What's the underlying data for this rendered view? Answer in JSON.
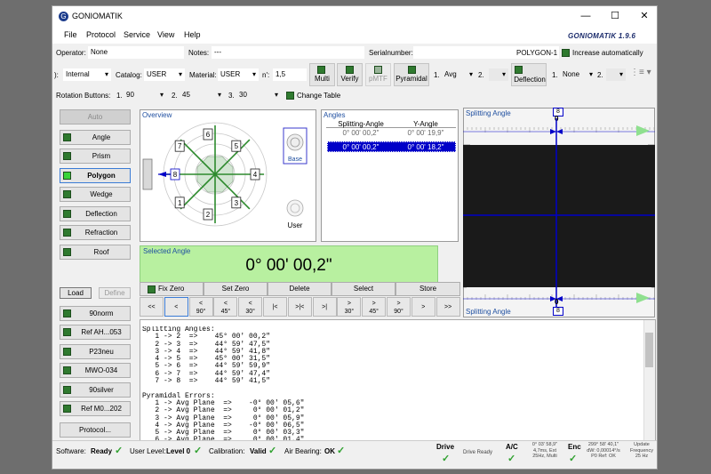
{
  "window": {
    "title": "GONIOMATIK",
    "brand": "GONIOMATIK 1.9.6",
    "minimize": "—",
    "maximize": "☐",
    "close": "✕"
  },
  "menu": [
    "File",
    "Protocol",
    "Service",
    "View",
    "Help"
  ],
  "row1": {
    "operator_label": "Operator:",
    "operator_value": "None",
    "notes_label": "Notes:",
    "notes_value": "---",
    "serial_label": "Serialnumber:",
    "serial_value": "",
    "profile": "POLYGON-1",
    "increase_label": "Increase automatically"
  },
  "row2": {
    "mode_label": "):",
    "mode_value": "Internal",
    "catalog_label": "Catalog:",
    "catalog_value": "USER",
    "material_label": "Material:",
    "material_value": "USER",
    "n_label": "n':",
    "n_value": "1,5",
    "multi": "Multi",
    "verify": "Verify",
    "pmtf": "pMTF",
    "pyramidal": "Pyramidal",
    "p1_label": "1.",
    "p1_value": "Avg",
    "p2_label": "2.",
    "deflection": "Deflection",
    "d1_label": "1.",
    "d1_value": "None",
    "d2_label": "2."
  },
  "row3": {
    "label": "Rotation Buttons:",
    "r1_label": "1.",
    "r1_value": "90",
    "r2_label": "2.",
    "r2_value": "45",
    "r3_label": "3.",
    "r3_value": "30",
    "change_table": "Change Table"
  },
  "sidebar": {
    "auto": "Auto",
    "modes": [
      "Angle",
      "Prism",
      "Polygon",
      "Wedge",
      "Deflection",
      "Refraction",
      "Roof"
    ],
    "load": "Load",
    "define": "Define",
    "presets": [
      "90norm",
      "Ref AH...053",
      "P23neu",
      "MWO-034",
      "90silver",
      "Ref M0...202"
    ],
    "protocol": "Protocol..."
  },
  "overview": {
    "title": "Overview",
    "base": "Base",
    "user": "User",
    "faces": [
      "1",
      "2",
      "3",
      "4",
      "5",
      "6",
      "7",
      "8"
    ]
  },
  "angles": {
    "title": "Angles",
    "col1": "Splitting-Angle",
    "col2": "Y-Angle",
    "rows": [
      [
        "0° 00' 00,2\"",
        "0° 00' 19,9\""
      ],
      [
        "0° 00' 00,2\"",
        "0° 00' 18,2\""
      ]
    ]
  },
  "splitting": {
    "title_top": "Splitting Angle",
    "title_bottom": "Splitting Angle",
    "face_top": "8",
    "zero_top": "0",
    "face_bottom": "8",
    "zero_bottom": "0"
  },
  "selected": {
    "title": "Selected Angle",
    "value": "0° 00' 00,2\""
  },
  "commands": [
    "Fix Zero",
    "Set Zero",
    "Delete",
    "Select",
    "Store"
  ],
  "nav": [
    [
      "<<",
      ""
    ],
    [
      "<",
      ""
    ],
    [
      "<",
      "90°"
    ],
    [
      "<",
      "45°"
    ],
    [
      "<",
      "30°"
    ],
    [
      "|<",
      ""
    ],
    [
      ">|<",
      ""
    ],
    [
      ">|",
      ""
    ],
    [
      ">",
      "30°"
    ],
    [
      ">",
      "45°"
    ],
    [
      ">",
      "90°"
    ],
    [
      ">",
      ""
    ],
    [
      ">>",
      ""
    ]
  ],
  "log": [
    "Splitting Angles:",
    "   1 -> 2  =>    45° 00' 00,2\"",
    "   2 -> 3  =>    44° 59' 47,5\"",
    "   3 -> 4  =>    44° 59' 41,8\"",
    "   4 -> 5  =>    45° 00' 31,5\"",
    "   5 -> 6  =>    44° 59' 59,9\"",
    "   6 -> 7  =>    44° 59' 47,4\"",
    "   7 -> 8  =>    44° 59' 41,5\"",
    "",
    "Pyramidal Errors:",
    "   1 -> Avg Plane  =>    -0° 00' 05,6\"",
    "   2 -> Avg Plane  =>     0° 00' 01,2\"",
    "   3 -> Avg Plane  =>     0° 00' 05,9\"",
    "   4 -> Avg Plane  =>    -0° 00' 06,5\"",
    "   5 -> Avg Plane  =>     0° 00' 03,3\"",
    "   6 -> Avg Plane  =>     0° 00' 01,4\""
  ],
  "status": {
    "software_label": "Software:",
    "software_value": "Ready",
    "user_label": "User Level:",
    "user_value": "Level 0",
    "cal_label": "Calibration:",
    "cal_value": "Valid",
    "air_label": "Air Bearing:",
    "air_value": "OK",
    "drive": "Drive",
    "drive_state": "Drive Ready",
    "ac": "A/C",
    "ac_l1": "0° 03' 58,9\"",
    "ac_l2": "4,7ms, Ext",
    "ac_l3": "25Hz, Multi",
    "enc": "Enc",
    "enc_l1": "299° 58' 40,1\"",
    "enc_l2": "dW: 0,00014°/s",
    "enc_l3": "P0 Ref: OK",
    "upd_l1": "Update",
    "upd_l2": "Frequency",
    "upd_l3": "25 Hz"
  },
  "colors": {
    "accent": "#1f4fa0",
    "led": "#2f7a2f",
    "selected_bg": "#b8f0a0",
    "highlight": "#0000c8"
  }
}
